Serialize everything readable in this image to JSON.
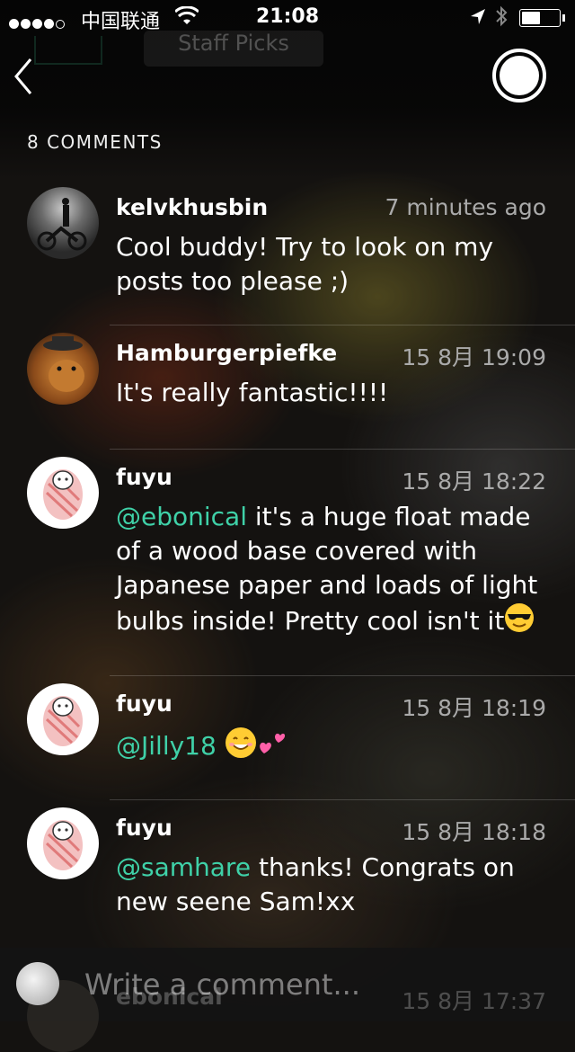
{
  "status_bar": {
    "carrier": "中国联通",
    "time": "21:08"
  },
  "nav": {
    "ghost_tab": "Staff Picks"
  },
  "comments_header": "8 COMMENTS",
  "comments": [
    {
      "user": "kelvkhusbin",
      "time": "7 minutes ago",
      "mention": "",
      "text": "Cool buddy! Try to look on my posts too please ;)",
      "avatar": "motorcycle-photo"
    },
    {
      "user": "Hamburgerpiefke",
      "time": "15 8月 19:09",
      "mention": "",
      "text": "It's really fantastic!!!!",
      "avatar": "dog-in-hat"
    },
    {
      "user": "fuyu",
      "time": "15 8月 18:22",
      "mention": "@ebonical",
      "text": " it's a huge float made of a wood base covered with Japanese paper and loads of light bulbs inside! Pretty cool isn't it",
      "emoji": "sunglasses-emoji",
      "avatar": "striped-character"
    },
    {
      "user": "fuyu",
      "time": "15 8月 18:19",
      "mention": "@Jilly18",
      "text": " ",
      "emoji": "smile-and-hearts-emoji",
      "avatar": "striped-character"
    },
    {
      "user": "fuyu",
      "time": "15 8月 18:18",
      "mention": "@samhare",
      "text": " thanks! Congrats on new seene Sam!xx",
      "avatar": "striped-character"
    }
  ],
  "peek_comment": {
    "user": "ebonical",
    "time": "15 8月 17:37"
  },
  "composer": {
    "placeholder": "Write a comment..."
  },
  "colors": {
    "mention": "#3fd1a8",
    "background": "#141210"
  }
}
